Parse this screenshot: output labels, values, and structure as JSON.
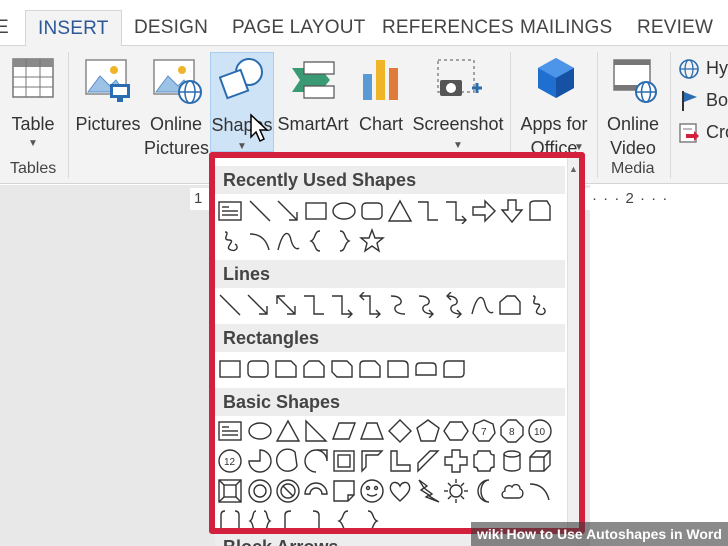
{
  "tabs": [
    {
      "label": "E",
      "active": false
    },
    {
      "label": "INSERT",
      "active": true
    },
    {
      "label": "DESIGN",
      "active": false
    },
    {
      "label": "PAGE LAYOUT",
      "active": false
    },
    {
      "label": "REFERENCES",
      "active": false
    },
    {
      "label": "MAILINGS",
      "active": false
    },
    {
      "label": "REVIEW",
      "active": false
    }
  ],
  "ribbon": {
    "table": {
      "label": "Table",
      "icon": "table-icon"
    },
    "tables_group": "Tables",
    "pictures": {
      "label": "Pictures",
      "icon": "pictures-icon"
    },
    "online_pictures": {
      "line1": "Online",
      "line2": "Pictures",
      "icon": "online-pictures-icon"
    },
    "shapes": {
      "label": "Shapes",
      "icon": "shapes-icon"
    },
    "smartart": {
      "label": "SmartArt",
      "icon": "smartart-icon"
    },
    "chart": {
      "label": "Chart",
      "icon": "chart-icon"
    },
    "screenshot": {
      "label": "Screenshot",
      "icon": "screenshot-icon"
    },
    "apps": {
      "line1": "Apps for",
      "line2": "Office",
      "icon": "apps-icon"
    },
    "online_video": {
      "line1": "Online",
      "line2": "Video",
      "icon": "online-video-icon"
    },
    "media_group": "Media",
    "links": [
      {
        "label": "Hy",
        "icon": "hyperlink-icon"
      },
      {
        "label": "Bo",
        "icon": "bookmark-icon"
      },
      {
        "label": "Cro",
        "icon": "cross-reference-icon"
      }
    ]
  },
  "ruler": {
    "left_mark": "1",
    "right_marks": "· · · 2 · · ·"
  },
  "gallery": {
    "sections": {
      "recent": "Recently Used Shapes",
      "lines": "Lines",
      "rectangles": "Rectangles",
      "basic": "Basic Shapes",
      "block_arrows": "Block Arrows"
    },
    "badge_labels": {
      "seven": "7",
      "eight": "8",
      "ten": "10",
      "twelve": "12"
    }
  },
  "watermark": {
    "brand": "wiki",
    "text": "How to Use Autoshapes in Word"
  },
  "colors": {
    "accent": "#2b579a",
    "highlight_border": "#d3203c",
    "shapes_hover": "#cfe3f7"
  }
}
